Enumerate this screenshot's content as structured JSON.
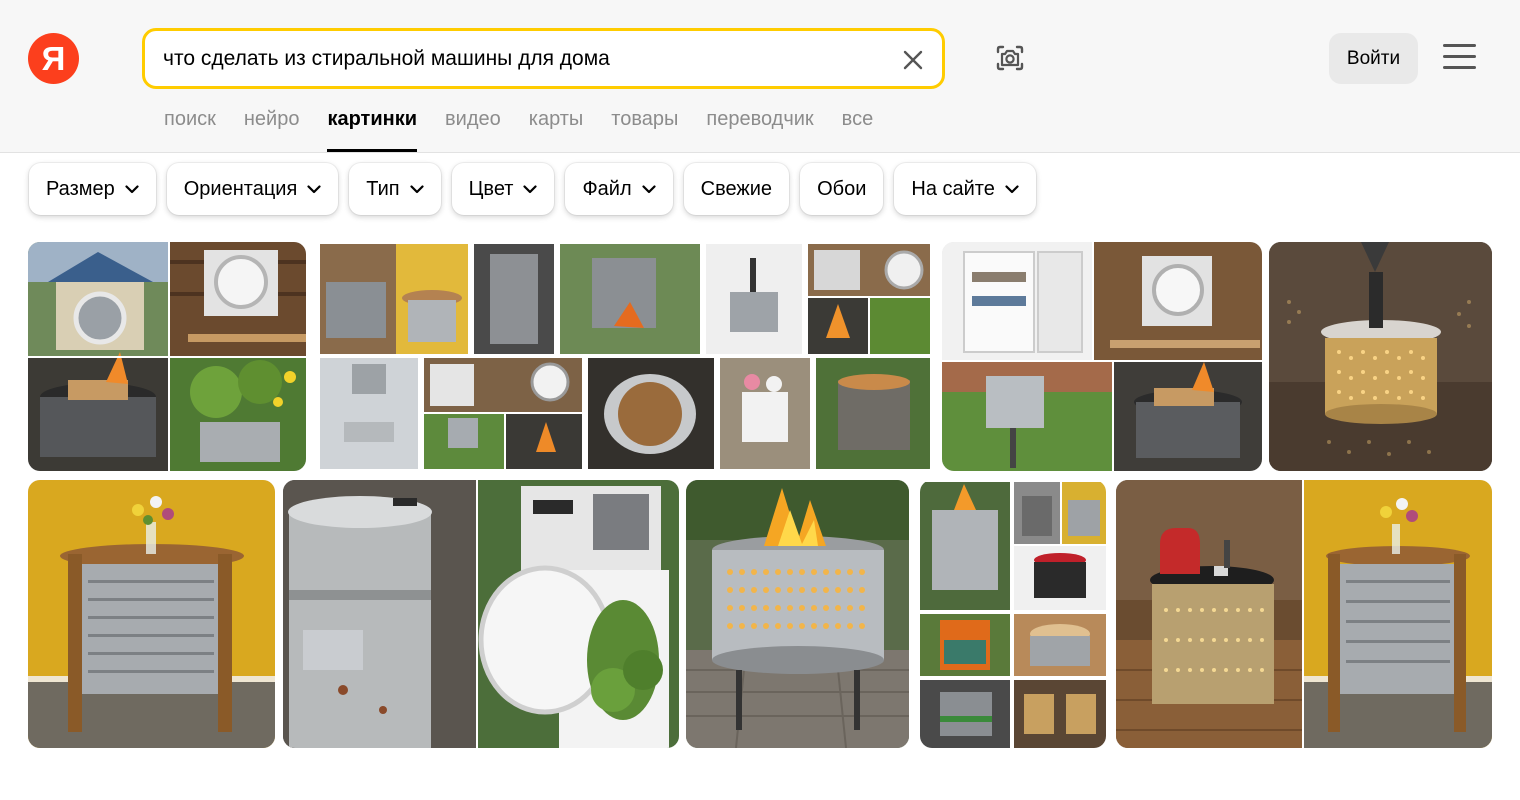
{
  "logo": {
    "letter": "Я",
    "color": "#fc3f1d"
  },
  "search": {
    "query": "что сделать из стиральной машины для дома",
    "accent": "#ffcc00"
  },
  "header": {
    "login_label": "Войти"
  },
  "tabs": [
    {
      "label": "поиск",
      "active": false
    },
    {
      "label": "нейро",
      "active": false
    },
    {
      "label": "картинки",
      "active": true
    },
    {
      "label": "видео",
      "active": false
    },
    {
      "label": "карты",
      "active": false
    },
    {
      "label": "товары",
      "active": false
    },
    {
      "label": "переводчик",
      "active": false
    },
    {
      "label": "все",
      "active": false
    }
  ],
  "filters": [
    {
      "label": "Размер",
      "dropdown": true
    },
    {
      "label": "Ориентация",
      "dropdown": true
    },
    {
      "label": "Тип",
      "dropdown": true
    },
    {
      "label": "Цвет",
      "dropdown": true
    },
    {
      "label": "Файл",
      "dropdown": true
    },
    {
      "label": "Свежие",
      "dropdown": false
    },
    {
      "label": "Обои",
      "dropdown": false
    },
    {
      "label": "На сайте",
      "dropdown": true
    }
  ],
  "results": [
    {
      "id": "collage-doghouse-drum",
      "subject": "collage: dog house, wall drum door, fire pit, flower planter"
    },
    {
      "id": "collage-large",
      "subject": "collage of many washing machine drum crafts"
    },
    {
      "id": "collage-fridge-drum",
      "subject": "collage: mini fridge, wall drum door, garden stand, fire pit"
    },
    {
      "id": "drum-lamp",
      "subject": "drum table lamp with light pattern"
    },
    {
      "id": "drum-side-table",
      "subject": "drum side table with flowers, yellow wall"
    },
    {
      "id": "drum-planter-door",
      "subject": "metal bin and washing machine door planter"
    },
    {
      "id": "drum-fire-pit",
      "subject": "drum fire pit on stone paving"
    },
    {
      "id": "collage-drum-furniture",
      "subject": "collage of drum fire pits, stools and lamps"
    },
    {
      "id": "drum-tables-collage",
      "subject": "drum tables with kettle and flowers"
    }
  ]
}
